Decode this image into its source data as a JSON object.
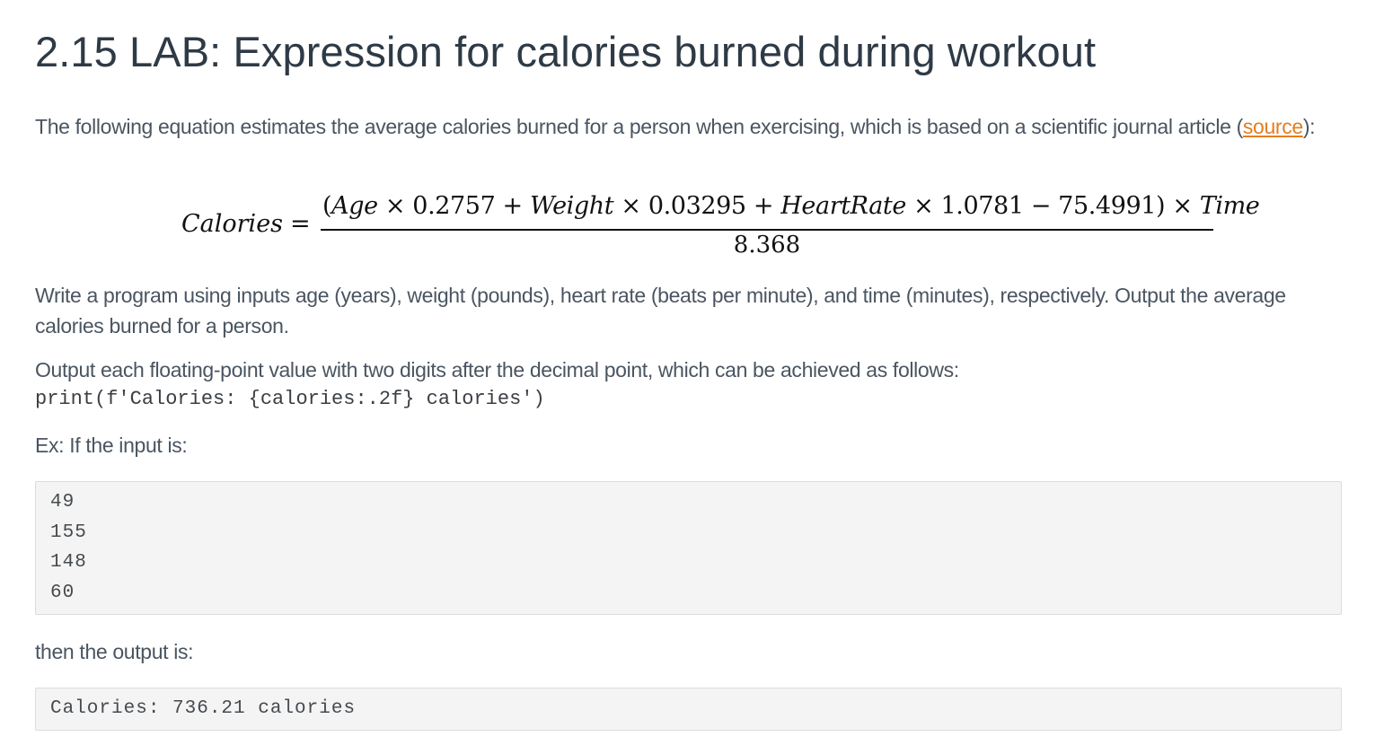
{
  "title": "2.15 LAB: Expression for calories burned during workout",
  "intro": {
    "text_before": "The following equation estimates the average calories burned for a person when exercising, which is based on a scientific journal article (",
    "link_text": "source",
    "text_after": "):"
  },
  "formula": {
    "lhs": "Calories",
    "equals": "=",
    "numerator": {
      "open": "(",
      "term1_var": "Age",
      "term1_op": " × 0.2757 + ",
      "term2_var": "Weight",
      "term2_op": " × 0.03295 + ",
      "term3_var": "HeartRate",
      "term3_op": " × 1.0781 − 75.4991) × ",
      "term4_var": "Time"
    },
    "denominator": "8.368"
  },
  "instructions": "Write a program using inputs age (years), weight (pounds), heart rate (beats per minute), and time (minutes), respectively. Output the average calories burned for a person.",
  "format_note": "Output each floating-point value with two digits after the decimal point, which can be achieved as follows:",
  "format_code": "print(f'Calories: {calories:.2f} calories')",
  "example_input_label": "Ex: If the input is:",
  "example_input": [
    "49",
    "155",
    "148",
    "60"
  ],
  "example_output_label": "then the output is:",
  "example_output": [
    "Calories: 736.21 calories"
  ],
  "colors": {
    "link": "#e37e21",
    "title": "#2e3a46",
    "body_text": "#4a5561",
    "code_box_bg": "#f4f4f4"
  }
}
